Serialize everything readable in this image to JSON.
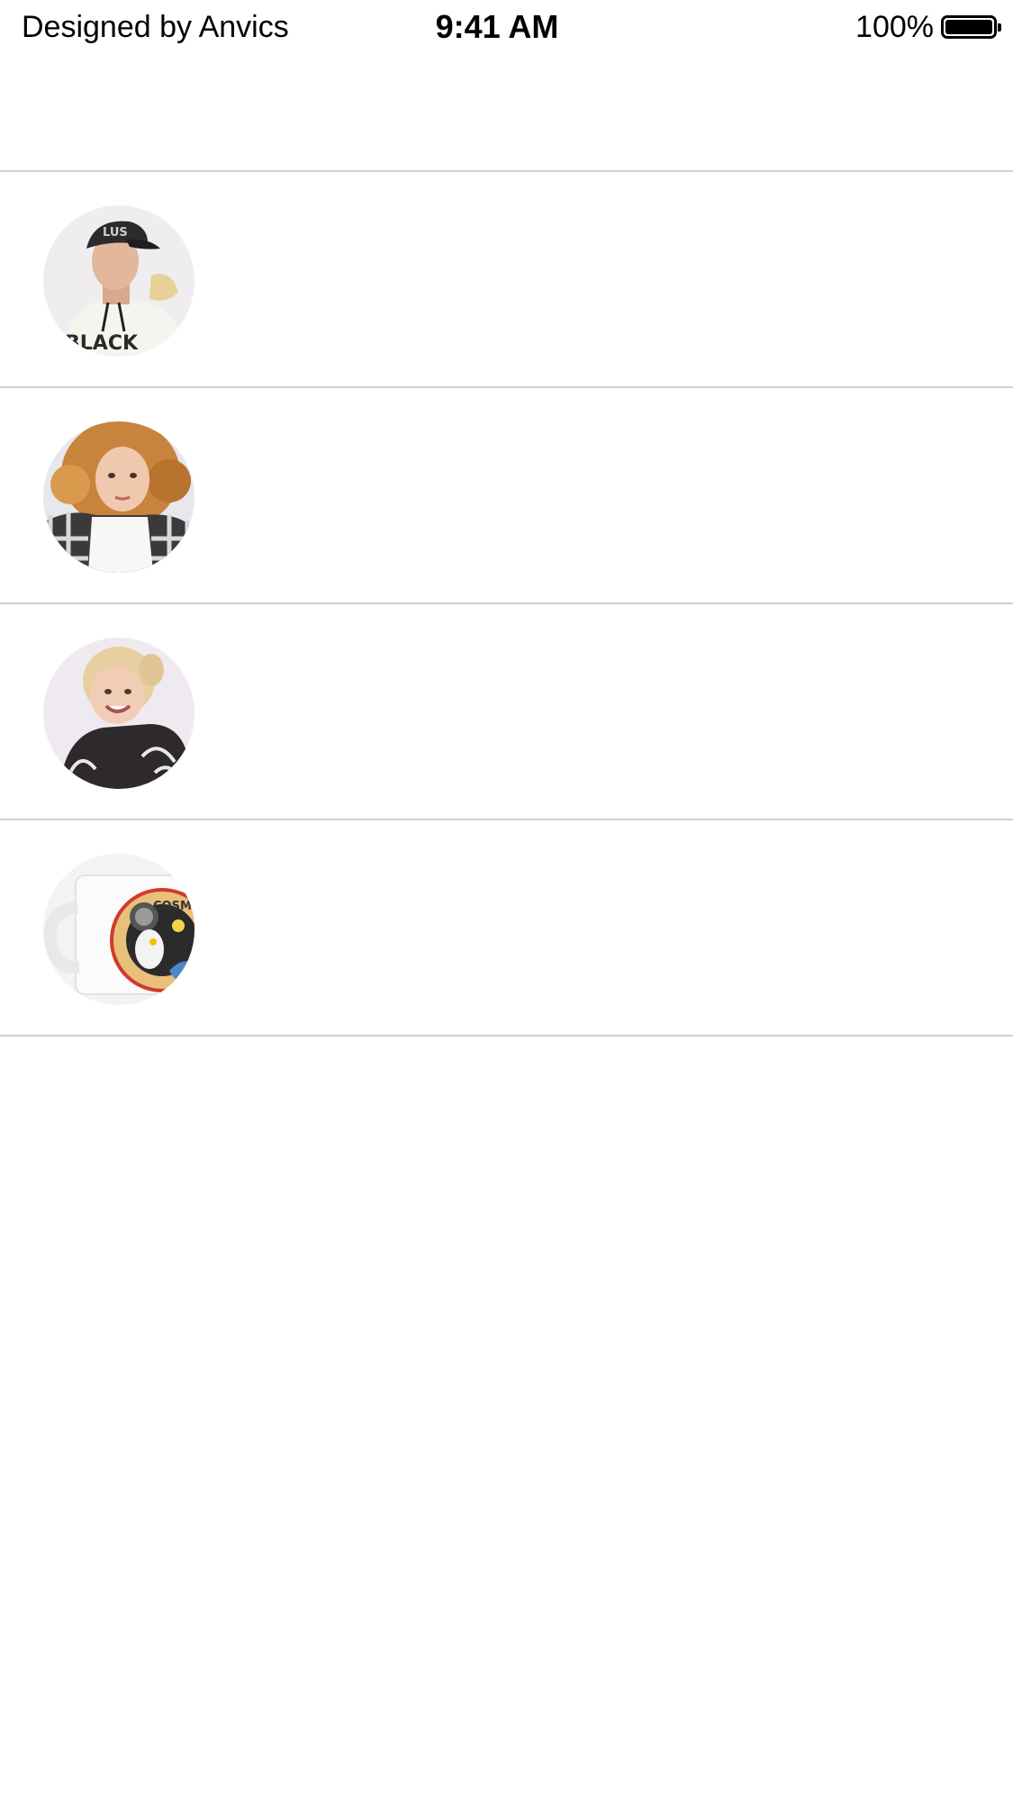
{
  "status_bar": {
    "carrier": "Designed by Anvics",
    "time": "9:41 AM",
    "battery_percent": "100%",
    "battery_level": 1.0
  },
  "list": {
    "items": [
      {
        "image": "man-in-cap-and-hoodie-photo",
        "hoodie_text": "BLACK"
      },
      {
        "image": "curly-haired-woman-in-plaid-jacket-photo"
      },
      {
        "image": "smiling-girl-in-black-hoodie-photo"
      },
      {
        "image": "mug-with-cosmonaut-print-photo",
        "print_text": "COSM"
      }
    ]
  },
  "colors": {
    "background": "#ffffff",
    "divider": "#cfcfcf",
    "avatar_bg": "#eeebef"
  }
}
